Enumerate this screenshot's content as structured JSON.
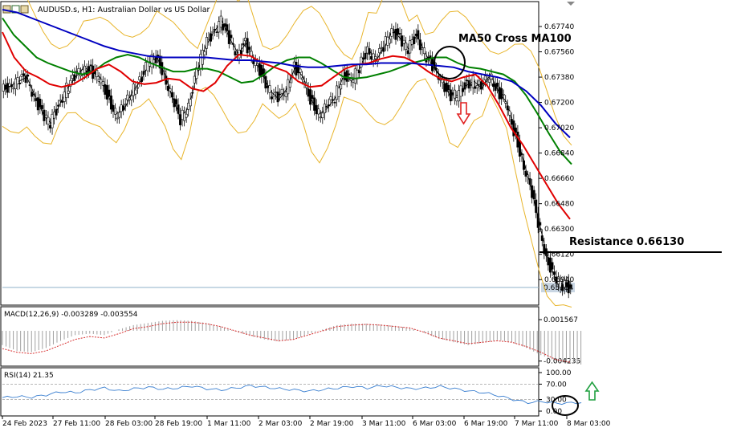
{
  "window": {
    "title": "AUDUSD.s, H1:  Australian Dollar vs US Dollar"
  },
  "chart_data": [
    {
      "type": "candlestick",
      "symbol": "AUDUSD.s",
      "timeframe": "H1",
      "ylim": [
        0.6577,
        0.6786
      ],
      "y_ticks": [
        "0.67740",
        "0.67560",
        "0.67380",
        "0.67200",
        "0.67020",
        "0.66840",
        "0.66660",
        "0.66480",
        "0.66300",
        "0.66120",
        "0.65940"
      ],
      "y_tick_values": [
        0.6774,
        0.6756,
        0.6738,
        0.672,
        0.6702,
        0.6684,
        0.6666,
        0.6648,
        0.663,
        0.6612,
        0.6594
      ],
      "current_price": "0.65884",
      "current_price_value": 0.65884,
      "price_path": [
        0.6728,
        0.6732,
        0.6735,
        0.6738,
        0.6725,
        0.6712,
        0.6705,
        0.6718,
        0.673,
        0.6738,
        0.6745,
        0.6742,
        0.6738,
        0.6725,
        0.6712,
        0.6715,
        0.6728,
        0.6735,
        0.6748,
        0.6752,
        0.674,
        0.6722,
        0.6708,
        0.6718,
        0.6742,
        0.676,
        0.677,
        0.6778,
        0.6765,
        0.6755,
        0.6762,
        0.675,
        0.674,
        0.6728,
        0.6722,
        0.673,
        0.6745,
        0.6738,
        0.6722,
        0.6712,
        0.6716,
        0.6724,
        0.674,
        0.6735,
        0.6745,
        0.6758,
        0.675,
        0.676,
        0.6772,
        0.6765,
        0.6758,
        0.6768,
        0.6755,
        0.6745,
        0.6738,
        0.6725,
        0.6725,
        0.6732,
        0.6735,
        0.673,
        0.674,
        0.6728,
        0.672,
        0.67,
        0.668,
        0.666,
        0.6635,
        0.661,
        0.6595,
        0.659,
        0.6588
      ],
      "indicators": [
        {
          "name": "MA (green)",
          "color": "#008000",
          "values": [
            0.678,
            0.6768,
            0.676,
            0.6752,
            0.6748,
            0.6745,
            0.6742,
            0.674,
            0.6742,
            0.6748,
            0.6752,
            0.6754,
            0.6752,
            0.6748,
            0.6745,
            0.6742,
            0.6742,
            0.6744,
            0.6744,
            0.6742,
            0.6738,
            0.6734,
            0.6735,
            0.674,
            0.6746,
            0.675,
            0.6752,
            0.6752,
            0.6748,
            0.6743,
            0.6738,
            0.6737,
            0.6738,
            0.674,
            0.6742,
            0.6745,
            0.6748,
            0.675,
            0.6752,
            0.6752,
            0.6748,
            0.6745,
            0.6744,
            0.6742,
            0.674,
            0.6735,
            0.6725,
            0.6712,
            0.6698,
            0.6685,
            0.6676
          ]
        },
        {
          "name": "MA (red)",
          "color": "#e00000",
          "values": [
            0.677,
            0.6752,
            0.6742,
            0.6738,
            0.6733,
            0.6731,
            0.6733,
            0.6738,
            0.6744,
            0.6747,
            0.6742,
            0.6735,
            0.6733,
            0.6734,
            0.6737,
            0.6736,
            0.673,
            0.6728,
            0.6734,
            0.6746,
            0.6754,
            0.6753,
            0.6748,
            0.6745,
            0.6742,
            0.6735,
            0.6731,
            0.6732,
            0.6738,
            0.6744,
            0.6747,
            0.6748,
            0.6751,
            0.6753,
            0.6752,
            0.6748,
            0.6742,
            0.6737,
            0.6735,
            0.6738,
            0.674,
            0.6732,
            0.6718,
            0.6702,
            0.669,
            0.6676,
            0.6662,
            0.6648,
            0.6637
          ]
        },
        {
          "name": "MA (blue)",
          "color": "#0000c0",
          "values": [
            0.6786,
            0.6784,
            0.678,
            0.6776,
            0.6772,
            0.6768,
            0.6764,
            0.676,
            0.6757,
            0.6755,
            0.6753,
            0.6752,
            0.6752,
            0.6752,
            0.6752,
            0.6751,
            0.675,
            0.675,
            0.6749,
            0.6748,
            0.6746,
            0.6745,
            0.6745,
            0.6746,
            0.6747,
            0.6747,
            0.6748,
            0.6748,
            0.6748,
            0.6747,
            0.6746,
            0.6745,
            0.6742,
            0.674,
            0.6738,
            0.6735,
            0.6728,
            0.6718,
            0.6705,
            0.6695
          ]
        }
      ],
      "annotations": [
        {
          "text": "MA50 Cross MA100",
          "price": 0.6762
        },
        {
          "text": "Resistance 0.66130",
          "price": 0.6613
        }
      ]
    },
    {
      "type": "line",
      "name": "MACD(12,26,9) -0.003289 -0.003554",
      "label": "MACD(12,26,9) -0.003289 -0.003554",
      "ylim": [
        -0.0045,
        0.0018
      ],
      "y_ticks": [
        "0.001567",
        "-0.004235"
      ],
      "y_tick_values": [
        0.001567,
        -0.004235
      ],
      "signal": [
        -0.0025,
        -0.003,
        -0.0032,
        -0.0028,
        -0.002,
        -0.0012,
        -0.0008,
        -0.001,
        -0.0004,
        0.0003,
        0.0006,
        0.001,
        0.0012,
        0.0012,
        0.001,
        0.0006,
        0.0,
        -0.0006,
        -0.001,
        -0.0014,
        -0.0012,
        -0.0006,
        0.0,
        0.0006,
        0.0008,
        0.0009,
        0.0008,
        0.0006,
        0.0004,
        -0.0002,
        -0.001,
        -0.0014,
        -0.0018,
        -0.0016,
        -0.0014,
        -0.0016,
        -0.0022,
        -0.003,
        -0.004,
        -0.0044
      ],
      "main": [
        -0.002,
        -0.0028,
        -0.003,
        -0.0024,
        -0.0014,
        -0.0006,
        -0.0004,
        -0.0006,
        0.0002,
        0.0008,
        0.0011,
        0.0014,
        0.0015,
        0.0014,
        0.0011,
        0.0006,
        -0.0001,
        -0.0007,
        -0.0012,
        -0.0015,
        -0.0012,
        -0.0005,
        0.0002,
        0.0008,
        0.001,
        0.001,
        0.0009,
        0.0007,
        0.0004,
        -0.0003,
        -0.0011,
        -0.0016,
        -0.002,
        -0.0017,
        -0.0013,
        -0.0016,
        -0.0024,
        -0.0034,
        -0.0042,
        -0.0045
      ]
    },
    {
      "type": "line",
      "name": "RSI(14) 21.35",
      "label": "RSI(14) 21.35",
      "ylim": [
        0,
        100
      ],
      "y_ticks": [
        "100.00",
        "70.00",
        "30.00",
        "0.00"
      ],
      "y_tick_values": [
        100,
        70,
        30,
        0
      ],
      "values": [
        35,
        38,
        36,
        42,
        50,
        48,
        55,
        60,
        52,
        58,
        62,
        57,
        60,
        65,
        58,
        55,
        60,
        66,
        62,
        58,
        55,
        52,
        56,
        60,
        64,
        60,
        66,
        62,
        58,
        60,
        64,
        58,
        52,
        48,
        40,
        30,
        22,
        25,
        20,
        21.35
      ]
    }
  ],
  "x_axis": {
    "labels": [
      "24 Feb 2023",
      "27 Feb 11:00",
      "28 Feb 03:00",
      "28 Feb 19:00",
      "1 Mar 11:00",
      "2 Mar 03:00",
      "2 Mar 19:00",
      "3 Mar 11:00",
      "6 Mar 03:00",
      "6 Mar 19:00",
      "7 Mar 11:00",
      "8 Mar 03:00"
    ]
  },
  "colors": {
    "price_line": "#8fb0c9",
    "candles": "#000000",
    "bollinger": "#e8b52c",
    "macd_signal": "#d83030",
    "macd_hist": "#a0a0a0",
    "rsi": "#3a7fd0",
    "arrow_down": "#e02020",
    "arrow_up": "#20a040"
  }
}
